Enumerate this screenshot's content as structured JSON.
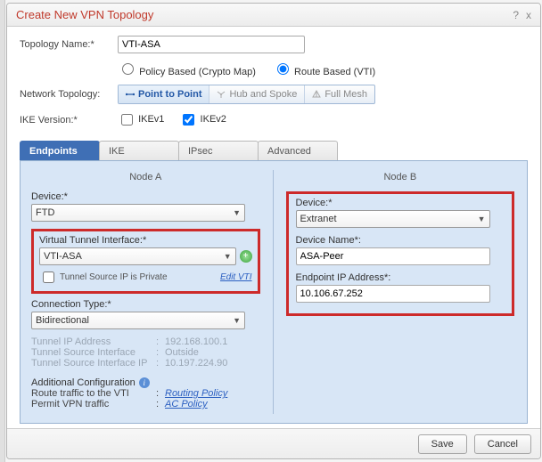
{
  "window": {
    "title": "Create New VPN Topology",
    "help": "?",
    "close": "x"
  },
  "form": {
    "topology_name_label": "Topology Name:*",
    "topology_name_value": "VTI-ASA",
    "policy_radio": {
      "policy": "Policy Based (Crypto Map)",
      "route": "Route Based (VTI)"
    },
    "network_topology_label": "Network Topology:",
    "topo_buttons": {
      "p2p": "Point to Point",
      "hub": "Hub and Spoke",
      "full": "Full Mesh"
    },
    "ike_label": "IKE Version:*",
    "ike": {
      "v1": "IKEv1",
      "v2": "IKEv2"
    }
  },
  "tabs": {
    "endpoints": "Endpoints",
    "ike": "IKE",
    "ipsec": "IPsec",
    "advanced": "Advanced"
  },
  "endpoints": {
    "nodeA": {
      "title": "Node A",
      "device_label": "Device:*",
      "device_value": "FTD",
      "vti_label": "Virtual Tunnel Interface:*",
      "vti_value": "VTI-ASA",
      "edit_vti": "Edit VTI",
      "tunnel_src_private_label": "Tunnel Source IP is Private",
      "conn_type_label": "Connection Type:*",
      "conn_type_value": "Bidirectional",
      "static": {
        "tunnel_ip_label": "Tunnel IP Address",
        "tunnel_ip_value": "192.168.100.1",
        "src_iface_label": "Tunnel Source Interface",
        "src_iface_value": "Outside",
        "src_iface_ip_label": "Tunnel Source Interface IP",
        "src_iface_ip_value": "10.197.224.90"
      },
      "addcfg_title": "Additional Configuration",
      "addcfg": {
        "route_label": "Route traffic to the VTI",
        "route_link": "Routing Policy",
        "permit_label": "Permit VPN traffic",
        "permit_link": "AC Policy"
      }
    },
    "nodeB": {
      "title": "Node B",
      "device_label": "Device:*",
      "device_value": "Extranet",
      "device_name_label": "Device Name*:",
      "device_name_value": "ASA-Peer",
      "endpoint_ip_label": "Endpoint IP Address*:",
      "endpoint_ip_value": "10.106.67.252"
    }
  },
  "footer": {
    "save": "Save",
    "cancel": "Cancel"
  }
}
